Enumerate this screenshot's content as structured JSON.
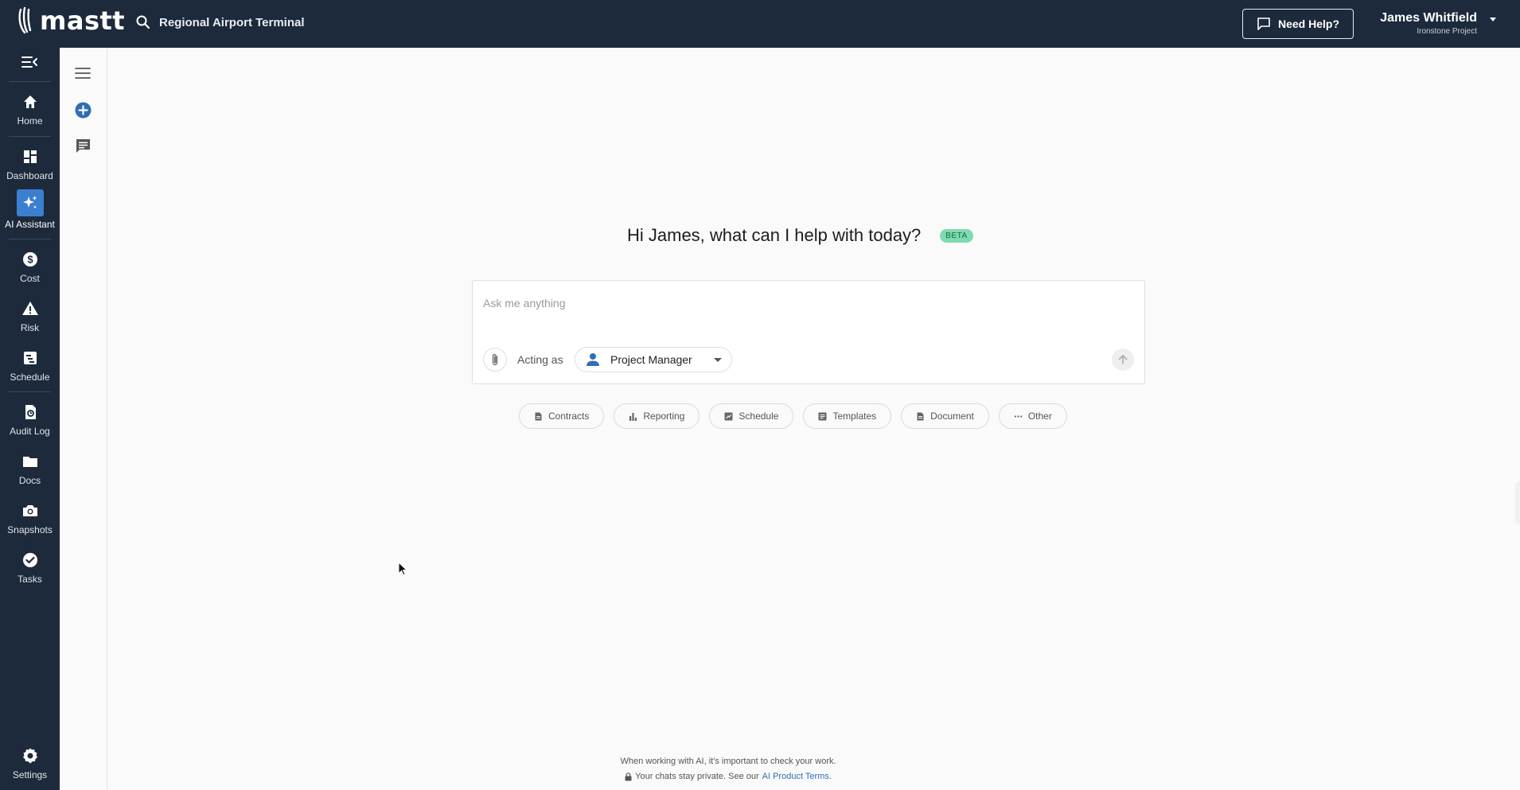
{
  "app": {
    "logo_text": "mastt",
    "project_name": "Regional Airport Terminal",
    "help_label": "Need Help?",
    "user_name": "James Whitfield",
    "user_project": "Ironstone Project"
  },
  "sidebar": {
    "items": [
      {
        "label": "Home",
        "icon": "home-icon"
      },
      {
        "label": "Dashboard",
        "icon": "dashboard-icon"
      },
      {
        "label": "AI Assistant",
        "icon": "sparkle-icon",
        "active": true
      },
      {
        "label": "Cost",
        "icon": "dollar-icon"
      },
      {
        "label": "Risk",
        "icon": "warning-icon"
      },
      {
        "label": "Schedule",
        "icon": "schedule-icon"
      },
      {
        "label": "Audit Log",
        "icon": "audit-icon"
      },
      {
        "label": "Docs",
        "icon": "folder-icon"
      },
      {
        "label": "Snapshots",
        "icon": "camera-icon"
      },
      {
        "label": "Tasks",
        "icon": "check-circle-icon"
      }
    ],
    "settings_label": "Settings"
  },
  "main": {
    "greeting": "Hi James, what can I help with today?",
    "badge": "BETA",
    "input_placeholder": "Ask me anything",
    "acting_as_label": "Acting as",
    "role": "Project Manager",
    "chips": [
      {
        "label": "Contracts",
        "icon": "contract-icon"
      },
      {
        "label": "Reporting",
        "icon": "bar-chart-icon"
      },
      {
        "label": "Schedule",
        "icon": "schedule-icon"
      },
      {
        "label": "Templates",
        "icon": "template-icon"
      },
      {
        "label": "Document",
        "icon": "document-icon"
      },
      {
        "label": "Other",
        "icon": "more-icon"
      }
    ],
    "footer_line1": "When working with AI, it's important to check your work.",
    "footer_line2": "Your chats stay private. See our",
    "footer_link": "AI Product Terms."
  },
  "colors": {
    "nav_bg": "#1d2a3c",
    "accent": "#3b7fd0",
    "beta_bg": "#7ddbb0",
    "link": "#2f6eb5"
  }
}
